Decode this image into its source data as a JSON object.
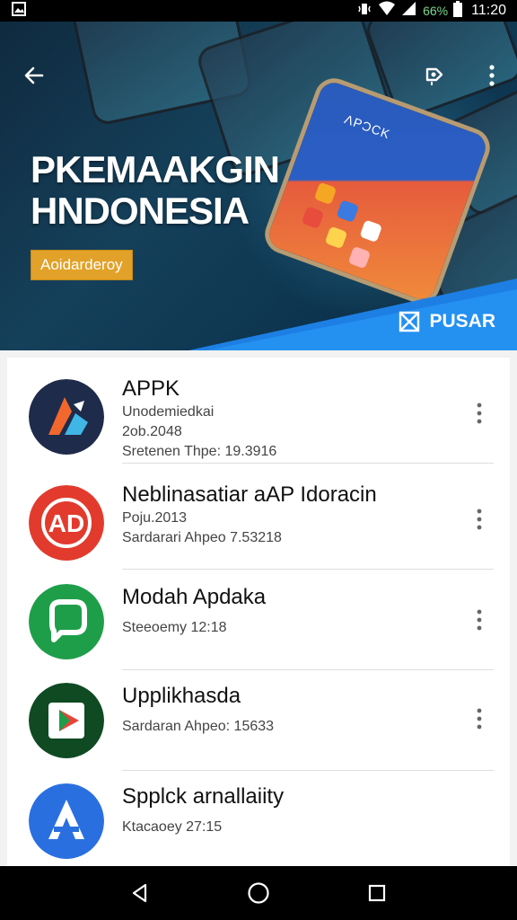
{
  "status_bar": {
    "battery_percent": "66%",
    "time": "11:20"
  },
  "hero": {
    "title_line1": "PKEMAAKGIN",
    "title_line2": "HNDONESIA",
    "badge": "Aoidarderoy",
    "phone_label": "ΛPƆCK",
    "pusar_label": "PUSAR"
  },
  "apps": [
    {
      "name": "APPK",
      "line1": "Unodemiedkai",
      "line2": "2ob.2048",
      "line3": "Sretenen Thpe: 19.3916",
      "icon": "appk-icon",
      "icon_colors": [
        "#1f2b4a",
        "#f2682c",
        "#3fb6e6"
      ]
    },
    {
      "name": "Neblinasatiar aAP Idoracin",
      "line1": "Poju.2013",
      "line2": "",
      "line3": "Sardarari Ahpeo 7.53218",
      "icon": "ad-icon",
      "icon_colors": [
        "#e23b2e",
        "#ffffff"
      ]
    },
    {
      "name": "Modah Apdaka",
      "line1": "",
      "line2": "",
      "line3": "Steeoemy 12:18",
      "icon": "chat-icon",
      "icon_colors": [
        "#1f9e4a",
        "#ffffff"
      ]
    },
    {
      "name": "Upplikhasda",
      "line1": "",
      "line2": "",
      "line3": "Sardaran Ahpeo: 15633",
      "icon": "play-icon",
      "icon_colors": [
        "#0f4a23",
        "#ffffff",
        "#e8433a"
      ]
    },
    {
      "name": "Spplck arnallaiity",
      "line1": "",
      "line2": "",
      "line3": "Ktacaoey 27:15",
      "icon": "app-store-icon",
      "icon_colors": [
        "#2a6fe0",
        "#ffffff"
      ]
    }
  ]
}
